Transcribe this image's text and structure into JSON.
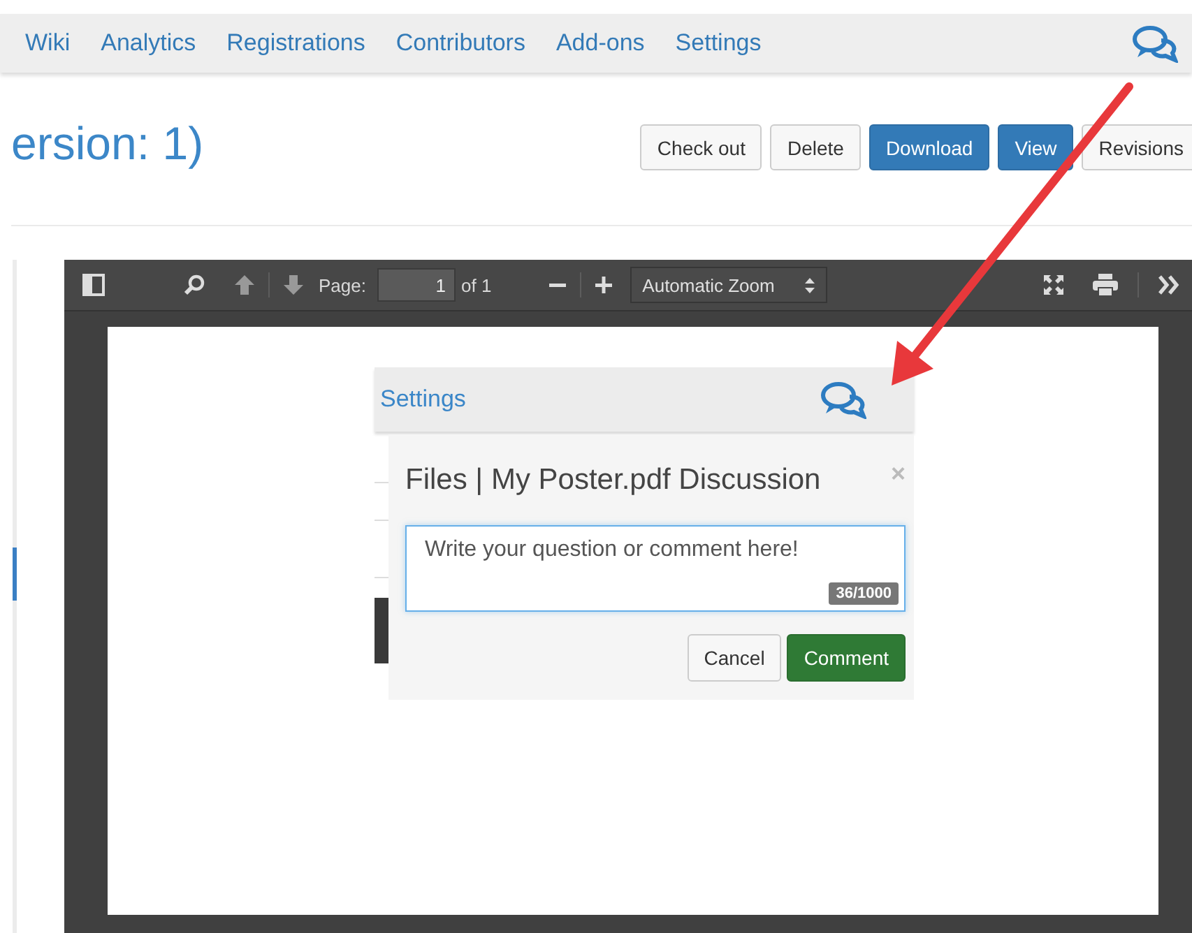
{
  "nav": {
    "items": [
      "Wiki",
      "Analytics",
      "Registrations",
      "Contributors",
      "Add-ons",
      "Settings"
    ]
  },
  "page_title": "ersion: 1)",
  "actions": [
    {
      "label": "Check out",
      "kind": "default"
    },
    {
      "label": "Delete",
      "kind": "default"
    },
    {
      "label": "Download",
      "kind": "primary"
    },
    {
      "label": "View",
      "kind": "primary"
    },
    {
      "label": "Revisions",
      "kind": "default"
    }
  ],
  "viewer": {
    "page_label": "Page:",
    "page_value": "1",
    "page_count": "of 1",
    "zoom": "Automatic Zoom"
  },
  "embedded": {
    "nav_item": "Settings",
    "dialog": {
      "title": "Files | My Poster.pdf Discussion",
      "close": "×",
      "comment": "Write your question or comment here!",
      "counter": "36/1000",
      "buttons": [
        {
          "label": "Cancel",
          "kind": "default"
        },
        {
          "label": "Comment",
          "kind": "success"
        }
      ]
    }
  }
}
